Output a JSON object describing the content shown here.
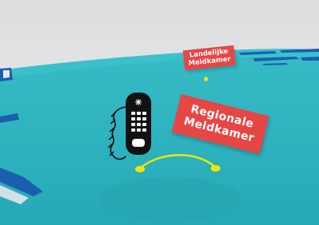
{
  "labels": {
    "national": {
      "line1": "Landelijke",
      "line2": "Meldkamer"
    },
    "regional": {
      "line1": "Regionale",
      "line2": "Meldkamer"
    }
  },
  "icons": {
    "phone": "telephone-handset-icon",
    "connection": "connection-arc"
  },
  "colors": {
    "sky": "#e6e7e8",
    "ground": "#2bb0bc",
    "ground_light": "#38c0cb",
    "border": "#1a5fae",
    "label": "#e84545",
    "phone": "#121212",
    "connector": "#f2e600"
  }
}
